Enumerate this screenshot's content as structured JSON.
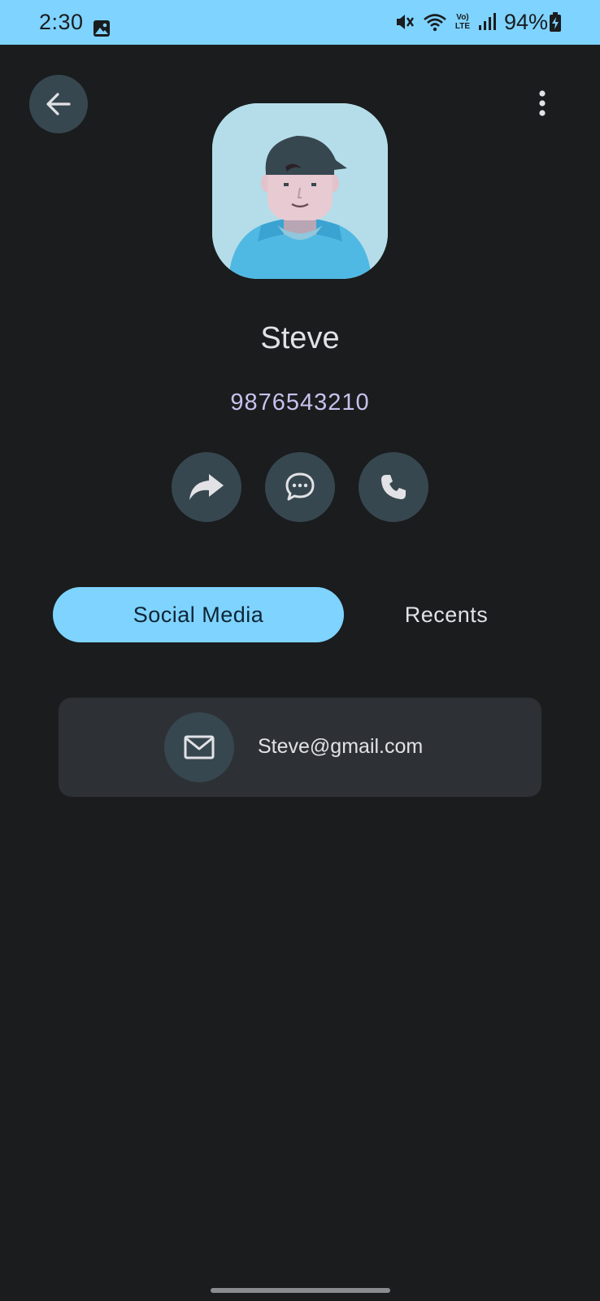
{
  "status_bar": {
    "time": "2:30",
    "battery": "94%",
    "network_label": "Vo) LTE",
    "icons": [
      "gallery-icon",
      "mute-vibrate-icon",
      "wifi-icon",
      "volte-icon",
      "signal-icon",
      "battery-charging-icon"
    ]
  },
  "toolbar": {
    "back_icon": "arrow-left-icon",
    "more_icon": "more-vertical-icon"
  },
  "contact": {
    "name": "Steve",
    "phone": "9876543210",
    "avatar": "person-avatar"
  },
  "actions": [
    {
      "name": "share",
      "icon": "share-icon"
    },
    {
      "name": "message",
      "icon": "message-icon"
    },
    {
      "name": "call",
      "icon": "phone-icon"
    }
  ],
  "tabs": [
    {
      "label": "Social Media",
      "selected": true
    },
    {
      "label": "Recents",
      "selected": false
    }
  ],
  "social": {
    "email": "Steve@gmail.com",
    "email_icon": "mail-icon"
  },
  "colors": {
    "background": "#1a1c1e",
    "accent": "#7fd3ff",
    "button_bg": "#37474f",
    "card_bg": "#2d3135",
    "phone_text": "#c4c2ec"
  }
}
